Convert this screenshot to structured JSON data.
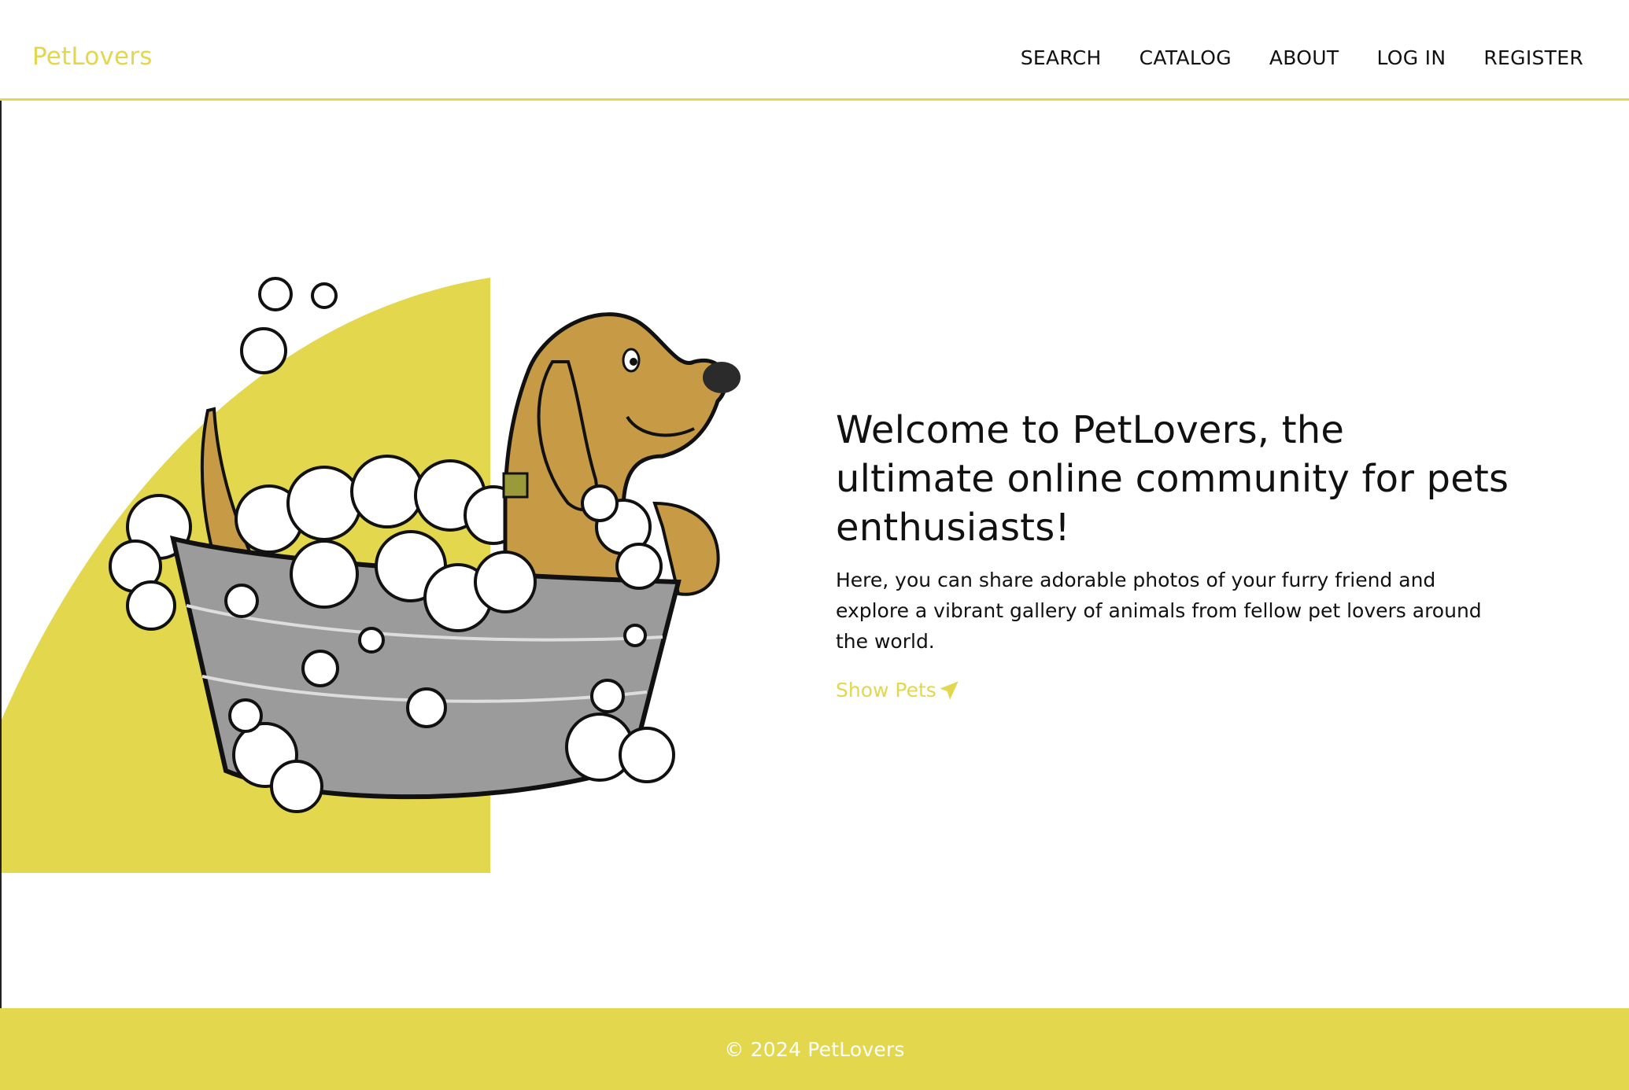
{
  "header": {
    "logo": "PetLovers",
    "nav": [
      {
        "label": "SEARCH"
      },
      {
        "label": "CATALOG"
      },
      {
        "label": "ABOUT"
      },
      {
        "label": "LOG IN"
      },
      {
        "label": "REGISTER"
      }
    ]
  },
  "hero": {
    "title": "Welcome to PetLovers, the ultimate online community for pets enthusiasts!",
    "description": "Here, you can share adorable photos of your furry friend and explore a vibrant gallery of animals from fellow pet lovers around the world.",
    "link_label": "Show Pets",
    "link_icon": "paper-plane-icon",
    "illustration": "dog-in-bathtub-illustration"
  },
  "footer": {
    "copyright": "© 2024 PetLovers"
  },
  "colors": {
    "accent": "#e2d74d",
    "text": "#111111",
    "background": "#ffffff",
    "dog": "#c79a45",
    "tub": "#9b9b9b"
  }
}
